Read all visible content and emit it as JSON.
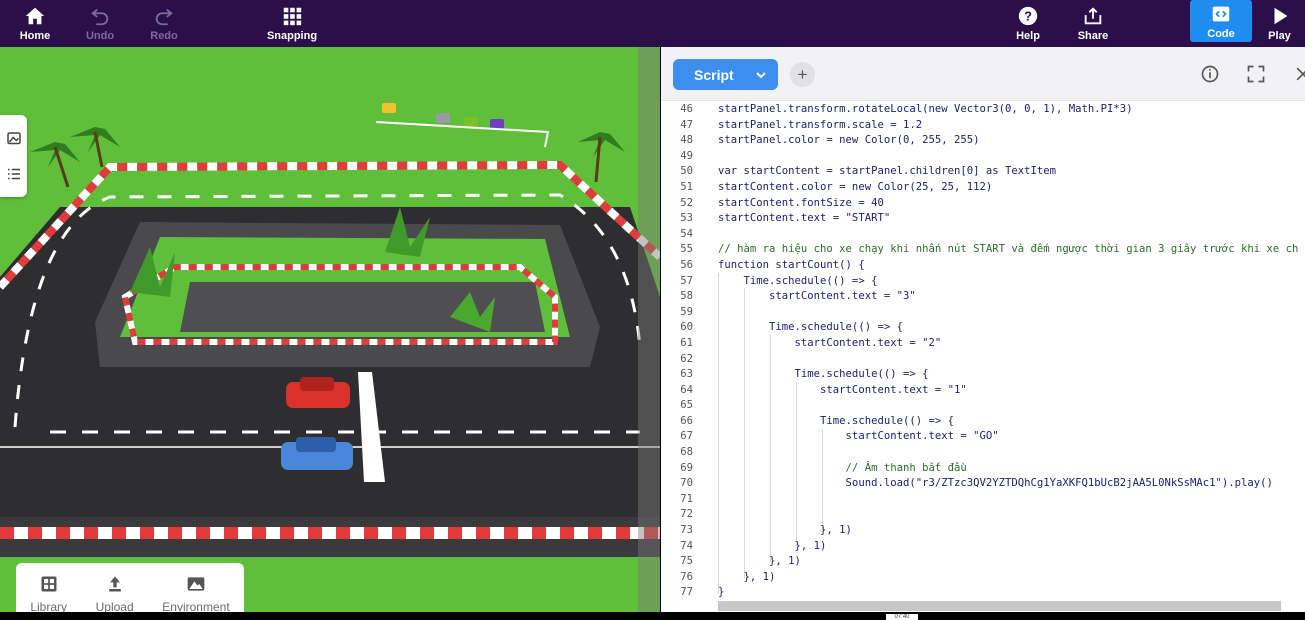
{
  "toolbar": {
    "home": "Home",
    "undo": "Undo",
    "redo": "Redo",
    "snapping": "Snapping",
    "help": "Help",
    "share": "Share",
    "code": "Code",
    "play": "Play"
  },
  "scene_tools": {
    "library": "Library",
    "upload": "Upload",
    "environment": "Environment"
  },
  "editor": {
    "script_label": "Script",
    "plus": "+"
  },
  "code_lines": [
    {
      "n": "46"
    },
    {
      "n": "47"
    },
    {
      "n": "48"
    },
    {
      "n": "49"
    },
    {
      "n": "50"
    },
    {
      "n": "51"
    },
    {
      "n": "52"
    },
    {
      "n": "53"
    },
    {
      "n": "54"
    },
    {
      "n": "55"
    },
    {
      "n": "56"
    },
    {
      "n": "57"
    },
    {
      "n": "58"
    },
    {
      "n": "59"
    },
    {
      "n": "60"
    },
    {
      "n": "61"
    },
    {
      "n": "62"
    },
    {
      "n": "63"
    },
    {
      "n": "64"
    },
    {
      "n": "65"
    },
    {
      "n": "66"
    },
    {
      "n": "67"
    },
    {
      "n": "68"
    },
    {
      "n": "69"
    },
    {
      "n": "70"
    },
    {
      "n": "71"
    },
    {
      "n": "72"
    },
    {
      "n": "73"
    },
    {
      "n": "74"
    },
    {
      "n": "75"
    },
    {
      "n": "76"
    },
    {
      "n": "77"
    }
  ],
  "code": {
    "l46": "startPanel.transform.rotateLocal(new Vector3(0, 0, 1), Math.PI*3)",
    "l47": "startPanel.transform.scale = 1.2",
    "l48": "startPanel.color = new Color(0, 255, 255)",
    "l50": "var startContent = startPanel.children[0] as TextItem",
    "l51": "startContent.color = new Color(25, 25, 112)",
    "l52": "startContent.fontSize = 40",
    "l53": "startContent.text = \"START\"",
    "l55": "// hàm ra hiệu cho xe chạy khi nhấn nút START và đếm ngược thời gian 3 giây trước khi xe ch",
    "l56": "function startCount() {",
    "l57": "    Time.schedule(() => {",
    "l58": "        startContent.text = \"3\"",
    "l60": "        Time.schedule(() => {",
    "l61": "            startContent.text = \"2\"",
    "l63": "            Time.schedule(() => {",
    "l64": "                startContent.text = \"1\"",
    "l66": "                Time.schedule(() => {",
    "l67": "                    startContent.text = \"GO\"",
    "l69": "                    // Âm thanh bắt đầu",
    "l70": "                    Sound.load(\"r3/ZTzc3QV2YZTDQhCg1YaXKFQ1bUcB2jAA5L0NkSsMAc1\").play()",
    "l73": "                }, 1)",
    "l74": "            }, 1)",
    "l75": "        }, 1)",
    "l76": "    }, 1)",
    "l77": "}"
  },
  "colors": {
    "toolbar_bg": "#2b0f4a",
    "accent": "#1e8cf0",
    "script_button": "#3d8ef0",
    "grass": "#5fbf3a",
    "road": "#2e2e30"
  },
  "clock": "07:40"
}
